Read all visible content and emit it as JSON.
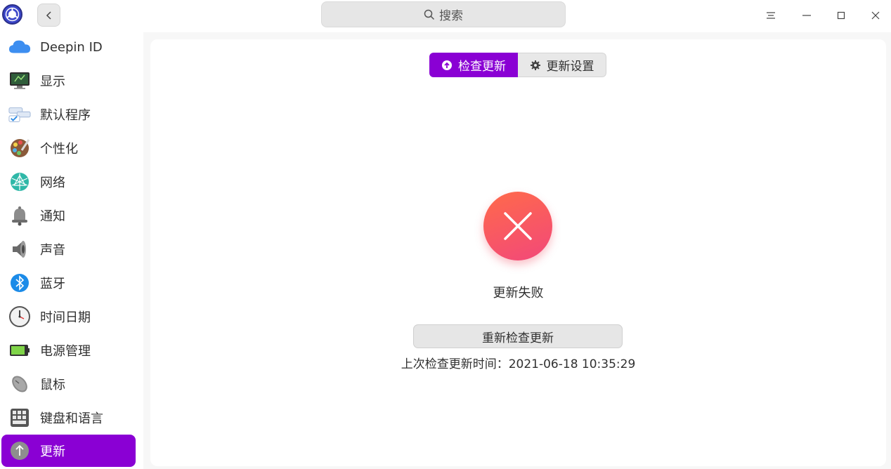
{
  "titlebar": {
    "search_placeholder": "搜索"
  },
  "sidebar": {
    "items": [
      {
        "label": "Deepin ID",
        "icon": "cloud-icon"
      },
      {
        "label": "显示",
        "icon": "monitor-icon"
      },
      {
        "label": "默认程序",
        "icon": "default-apps-icon"
      },
      {
        "label": "个性化",
        "icon": "palette-icon"
      },
      {
        "label": "网络",
        "icon": "network-icon"
      },
      {
        "label": "通知",
        "icon": "bell-icon"
      },
      {
        "label": "声音",
        "icon": "speaker-icon"
      },
      {
        "label": "蓝牙",
        "icon": "bluetooth-icon"
      },
      {
        "label": "时间日期",
        "icon": "clock-icon"
      },
      {
        "label": "电源管理",
        "icon": "battery-icon"
      },
      {
        "label": "鼠标",
        "icon": "mouse-icon"
      },
      {
        "label": "键盘和语言",
        "icon": "keyboard-icon"
      },
      {
        "label": "更新",
        "icon": "update-icon",
        "active": true
      }
    ]
  },
  "main": {
    "tabs": [
      {
        "label": "检查更新",
        "active": true
      },
      {
        "label": "更新设置",
        "active": false
      }
    ],
    "status_text": "更新失败",
    "retry_label": "重新检查更新",
    "last_check_text": "上次检查更新时间：2021-06-18 10:35:29"
  },
  "colors": {
    "accent": "#8a00d4",
    "error_start": "#ff6a4a",
    "error_end": "#f2487a"
  }
}
